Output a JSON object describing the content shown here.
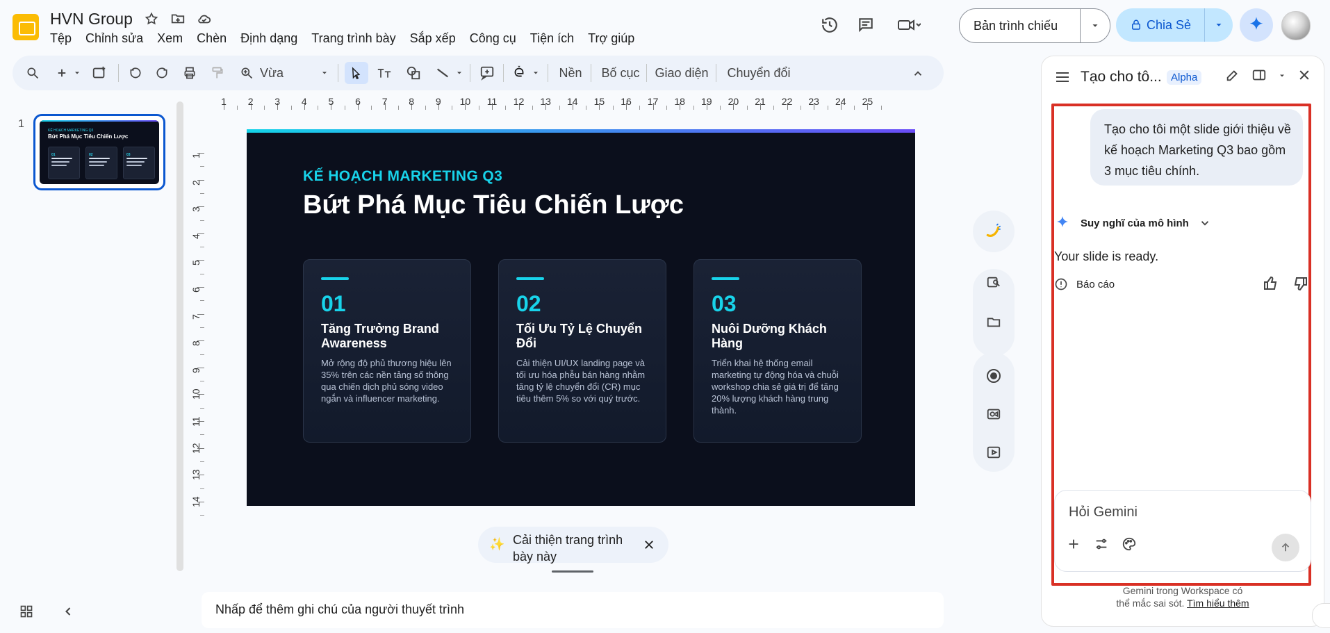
{
  "app": {
    "title": "HVN Group",
    "menu": [
      "Tệp",
      "Chỉnh sửa",
      "Xem",
      "Chèn",
      "Định dạng",
      "Trang trình bày",
      "Sắp xếp",
      "Công cụ",
      "Tiện ích",
      "Trợ giúp"
    ]
  },
  "top_right": {
    "present_label": "Bản trình chiếu",
    "share_label": "Chia Sẻ"
  },
  "toolbar": {
    "zoom_label": "Vừa",
    "background_label": "Nền",
    "layout_label": "Bố cục",
    "theme_label": "Giao diện",
    "transition_label": "Chuyển đổi"
  },
  "slides": {
    "number": "1",
    "thumb_kicker": "KẾ HOẠCH MARKETING Q3",
    "thumb_title": "Bứt Phá Mục Tiêu Chiến Lược"
  },
  "rulers": {
    "h": [
      "1",
      "2",
      "3",
      "4",
      "5",
      "6",
      "7",
      "8",
      "9",
      "10",
      "11",
      "12",
      "13",
      "14",
      "15",
      "16",
      "17",
      "18",
      "19",
      "20",
      "21",
      "22",
      "23",
      "24",
      "25"
    ],
    "v": [
      "1",
      "2",
      "3",
      "4",
      "5",
      "6",
      "7",
      "8",
      "9",
      "10",
      "11",
      "12",
      "13",
      "14"
    ]
  },
  "slide": {
    "kicker": "KẾ HOẠCH MARKETING Q3",
    "title": "Bứt Phá Mục Tiêu Chiến Lược",
    "cards": [
      {
        "num": "01",
        "title": "Tăng Trưởng Brand Awareness",
        "desc": "Mở rộng độ phủ thương hiệu lên 35% trên các nền tảng số thông qua chiến dịch phủ sóng video ngắn và influencer marketing."
      },
      {
        "num": "02",
        "title": "Tối Ưu Tỷ Lệ Chuyển Đổi",
        "desc": "Cải thiện UI/UX landing page và tối ưu hóa phễu bán hàng nhằm tăng tỷ lệ chuyển đổi (CR) mục tiêu thêm 5% so với quý trước."
      },
      {
        "num": "03",
        "title": "Nuôi Dưỡng Khách Hàng",
        "desc": "Triển khai hệ thống email marketing tự động hóa và chuỗi workshop chia sẻ giá trị để tăng 20% lượng khách hàng trung thành."
      }
    ]
  },
  "improve": {
    "text": "Cải thiện trang trình bày này"
  },
  "notes": {
    "placeholder": "Nhấp để thêm ghi chú của người thuyết trình"
  },
  "panel": {
    "title": "Tạo cho tô...",
    "badge": "Alpha",
    "user_message": "Tạo cho tôi một slide giới thiệu về kế hoạch Marketing Q3 bao gồm 3 mục tiêu chính.",
    "model_thoughts": "Suy nghĩ của mô hình",
    "assistant_reply": "Your slide is ready.",
    "report": "Báo cáo",
    "composer_placeholder": "Hỏi Gemini",
    "disclaimer_line1": "Gemini trong Workspace có",
    "disclaimer_line2": "thể mắc sai sót.",
    "learn_more": "Tìm hiểu thêm"
  },
  "icons": {
    "star": "star-icon",
    "move_to_folder": "folder-move-icon",
    "cloud": "cloud-icon",
    "history": "history-icon",
    "comment": "comment-icon",
    "meet": "video-call-icon",
    "gemini": "gemini-spark-icon"
  }
}
